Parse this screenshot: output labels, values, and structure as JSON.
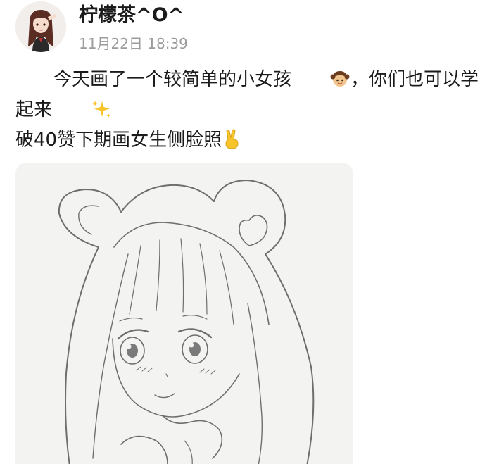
{
  "post": {
    "author": {
      "name": "柠檬茶^O^",
      "avatar_icon": "avatar-girl-saluting"
    },
    "timestamp": "11月22日 18:39",
    "text": {
      "line1_a": "今天画了一个较简单的小女孩",
      "line1_emoji": "girl-emoji",
      "line1_b": "，你们也可以学起来",
      "line1_emoji2": "sparkles-emoji",
      "line2": "破40赞下期画女生侧脸照",
      "line2_emoji": "victory-hand-emoji"
    },
    "image": {
      "subject_icon": "pencil-sketch-girl-bear-hood"
    },
    "colors": {
      "text": "#1b1b1b",
      "meta": "#9b9b9b",
      "sketch_line": "#6e6e6e",
      "paper": "#f3f3f1"
    }
  }
}
